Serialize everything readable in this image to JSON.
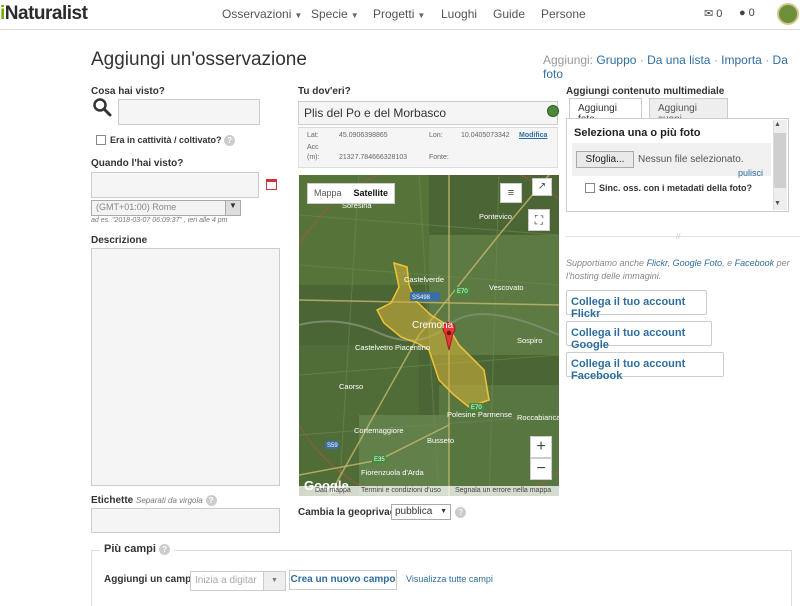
{
  "nav": {
    "logo": "Naturalist",
    "logo_i": "i",
    "items": [
      "Osservazioni",
      "Specie",
      "Progetti",
      "Luoghi",
      "Guide",
      "Persone"
    ],
    "mail_count": "0",
    "chat_count": "0"
  },
  "page": {
    "title": "Aggiungi un'osservazione",
    "add_prefix": "Aggiungi:",
    "add_links": [
      "Gruppo",
      "Da una lista",
      "Importa",
      "Da foto"
    ]
  },
  "what": {
    "label": "Cosa hai visto?",
    "value": ""
  },
  "captive": {
    "label": "Era in cattività / coltivato?"
  },
  "when": {
    "label": "Quando l'hai visto?",
    "value": "",
    "timezone": "(GMT+01:00) Rome",
    "example": "ad es. \"2018-03-07 06:09:37\" , ieri alle 4 pm"
  },
  "description": {
    "label": "Descrizione"
  },
  "tags": {
    "label": "Etichette",
    "hint": "Separati da virgola"
  },
  "location": {
    "label": "Tu dov'eri?",
    "place": "Plis del Po e del Morbasco",
    "lat_label": "Lat:",
    "lat": "45.0906398865",
    "lon_label": "Lon:",
    "lon": "10.0405073342",
    "edit": "Modifica",
    "acc_label": "Acc (m):",
    "acc": "21327.784666328103",
    "source_label": "Fonte:"
  },
  "map": {
    "tab_map": "Mappa",
    "tab_satellite": "Satellite",
    "zoom_in": "+",
    "zoom_out": "−",
    "google": "Google",
    "footer": [
      "Dati mappa",
      "Termini e condizioni d'uso",
      "Segnala un errore nella mappa"
    ],
    "places": [
      "Soresina",
      "Pontevico",
      "Castelverde",
      "Vescovato",
      "Cremona",
      "Castelvetro Piacentino",
      "Sospiro",
      "Caorso",
      "Polesine Parmense",
      "Roccabianca",
      "Cortemaggiore",
      "Busseto",
      "Fiorenzuola d'Arda"
    ],
    "roads": [
      "SS498",
      "E70",
      "E70",
      "S59",
      "E35"
    ]
  },
  "geoprivacy": {
    "label": "Cambia la geoprivacy",
    "value": "pubblica"
  },
  "media": {
    "label": "Aggiungi contenuto multimediale",
    "tab_photo": "Aggiungi foto",
    "tab_sound": "Aggiungi suoni",
    "select_label": "Seleziona una o più foto",
    "browse": "Sfoglia...",
    "no_file": "Nessun file selezionato.",
    "clear": "pulisci",
    "sync": "Sinc. oss. con i metadati della foto?"
  },
  "support": {
    "prefix": "Supportiamo anche ",
    "flickr": "Flickr",
    "comma": ", ",
    "google": "Google Foto",
    "and": ", e ",
    "facebook": "Facebook",
    "suffix": " per l'hosting delle immagini."
  },
  "accounts": [
    "Collega il tuo account Flickr",
    "Collega il tuo account Google",
    "Collega il tuo account Facebook"
  ],
  "more": {
    "title": "Più campi",
    "add_field": "Aggiungi un campo",
    "placeholder": "Inizia a digitar",
    "create": "Crea un nuovo campo",
    "view_all": "Visualizza tutte campi"
  },
  "colors": {
    "accent_green": "#74ac00",
    "link_blue": "#2e6e9e",
    "marker_red": "#e53935"
  }
}
